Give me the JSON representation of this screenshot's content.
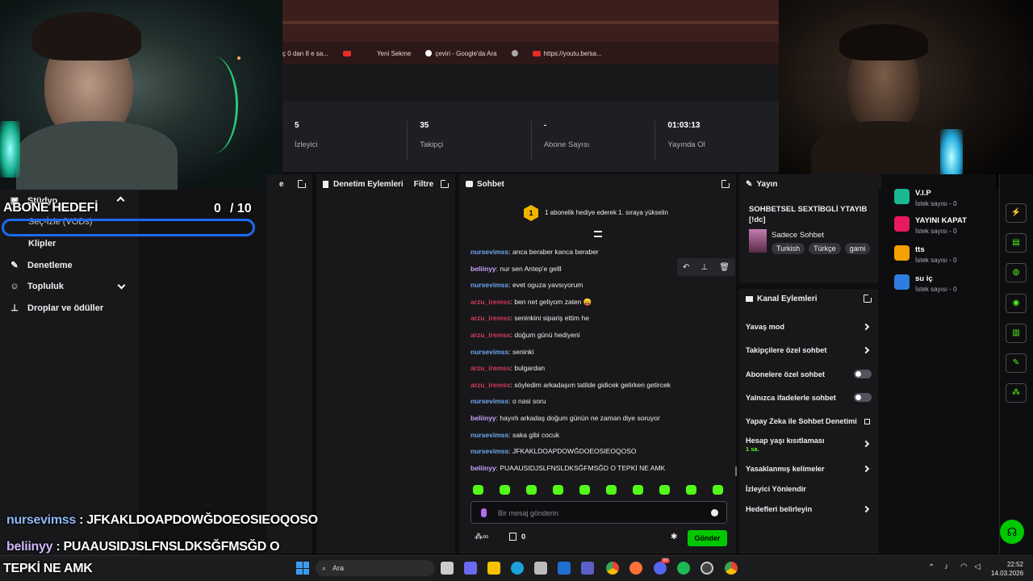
{
  "browser": {
    "bookmarks": [
      {
        "icon": "none",
        "label": "ç 0 dan 8 e sa..."
      },
      {
        "icon": "youtube-icon",
        "label": ""
      },
      {
        "icon": "youtube-icon",
        "label": "Yeni Sekme"
      },
      {
        "icon": "google-icon",
        "label": "çeviri - Google'da Ara"
      },
      {
        "icon": "globe-icon",
        "label": ""
      },
      {
        "icon": "youtube-icon",
        "label": "https://youtu.be/sa..."
      }
    ]
  },
  "stats": [
    {
      "value": "5",
      "label": "İzleyici"
    },
    {
      "value": "35",
      "label": "Takipçi"
    },
    {
      "value": "-",
      "label": "Abone Sayısı"
    },
    {
      "value": "01:03:13",
      "label": "Yayında Ol"
    }
  ],
  "sidebar": {
    "items": [
      {
        "label": "Stüdyo",
        "icon": "studio-icon"
      },
      {
        "label": "Seç-İzle (VODs)",
        "icon": ""
      },
      {
        "label": "Klipler",
        "icon": ""
      },
      {
        "label": "Denetleme",
        "icon": "wrench-icon"
      },
      {
        "label": "Topluluk",
        "icon": "community-icon"
      },
      {
        "label": "Droplar ve ödüller",
        "icon": "drops-icon"
      }
    ]
  },
  "overlay": {
    "goal_title": "ABONE HEDEFİ",
    "goal_current": "0",
    "goal_target": "/ 10",
    "chat1_user": "nursevimss",
    "chat1_text": ": JFKAKLDOAPDOWĞDOEOSIEOQOSO",
    "chat2_user": "beliinyy",
    "chat2_text": ": PUAAUSIDJSLFNSLDKSĞFMSĞD O",
    "chat3_text": "TEPKİ NE AMK"
  },
  "panels": {
    "left_suffix": "e",
    "moderation_title": "Denetim Eylemleri",
    "moderation_filter": "Filtre",
    "chat_title": "Sohbet",
    "stream_title": "Yayın"
  },
  "chat": {
    "gift_rank": "1",
    "gift_banner": "1 abonelik hediye ederek 1. sıraya yükselin",
    "messages": [
      {
        "user": "nursevimss",
        "color": "blue",
        "text": ": anca beraber kanca beraber"
      },
      {
        "user": "beliinyy",
        "color": "purple",
        "text": ": nur sen Antep'e gelll"
      },
      {
        "user": "nursevimss",
        "color": "blue",
        "text": ": evet oguza yavsıyorum"
      },
      {
        "user": "arzu_iremss",
        "color": "red",
        "text": ": ben net geliyom zaten 😛"
      },
      {
        "user": "arzu_iremss",
        "color": "red",
        "text": ": seninkini sipariş ettim he"
      },
      {
        "user": "arzu_iremss",
        "color": "red",
        "text": ": doğum günü hediyeni"
      },
      {
        "user": "nursevimss",
        "color": "blue",
        "text": ": seninki"
      },
      {
        "user": "arzu_iremss",
        "color": "red",
        "text": ": bulgardan"
      },
      {
        "user": "arzu_iremss",
        "color": "red",
        "text": ": söyledim arkadaşım tatilde gidicek gelirken getircek"
      },
      {
        "user": "nursevimss",
        "color": "blue",
        "text": ": o nasi soru"
      },
      {
        "user": "beliinyy",
        "color": "purple",
        "text": ": hayırlı arkadaş doğum günün ne zaman diye soruyor"
      },
      {
        "user": "nursevimss",
        "color": "blue",
        "text": ": saka gibi cocuk"
      },
      {
        "user": "nursevimss",
        "color": "blue",
        "text": ": JFKAKLDOAPDOWĞDOEOSIEOQOSO"
      },
      {
        "user": "beliinyy",
        "color": "purple",
        "text": ": PUAAUSIDJSLFNSLDKSĞFMSĞD O TEPKİ NE AMK"
      }
    ],
    "input_placeholder": "Bir mesaj gönderin",
    "points_count": "0",
    "send_label": "Gönder"
  },
  "stream_info": {
    "title": "SOHBETSEL SEXTİBGLİ YTAYIB [!dc]",
    "category": "Sadece Sohbet",
    "tags": [
      "Turkish",
      "Türkçe",
      "gami"
    ]
  },
  "channel_actions": {
    "title": "Kanal Eylemleri",
    "items": [
      {
        "label": "Yavaş mod",
        "control": "chevron"
      },
      {
        "label": "Takipçilere özel sohbet",
        "control": "chevron"
      },
      {
        "label": "Abonelere özel sohbet",
        "control": "toggle",
        "on": false
      },
      {
        "label": "Yalnızca ifadelerle sohbet",
        "control": "toggle",
        "on": false
      },
      {
        "label": "Yapay Zeka ile Sohbet Denetimi",
        "control": "external"
      },
      {
        "label": "Hesap yaşı kısıtlaması",
        "sub": "1 sa.",
        "control": "chevron"
      },
      {
        "label": "Yasaklanmış kelimeler",
        "control": "chevron"
      },
      {
        "label": "İzleyici Yönlendir",
        "control": "none"
      },
      {
        "label": "Hedefleri belirleyin",
        "control": "chevron"
      }
    ]
  },
  "rewards": [
    {
      "title": "V.I.P",
      "sub": "İstek sayısı - 0",
      "color": "#19b893"
    },
    {
      "title": "YAYINI KAPAT",
      "sub": "İstek sayısı - 0",
      "color": "#e8195c"
    },
    {
      "title": "tts",
      "sub": "İstek sayısı - 0",
      "color": "#f5a000"
    },
    {
      "title": "su iç",
      "sub": "İstek sayısı - 0",
      "color": "#2f7de1"
    }
  ],
  "taskbar": {
    "search_label": "Ara",
    "time": "22:52",
    "date": "14.03.2026",
    "badge_discord": "99"
  },
  "colors": {
    "accent": "#53fc18",
    "send": "#00c800",
    "background": "#18181b"
  }
}
